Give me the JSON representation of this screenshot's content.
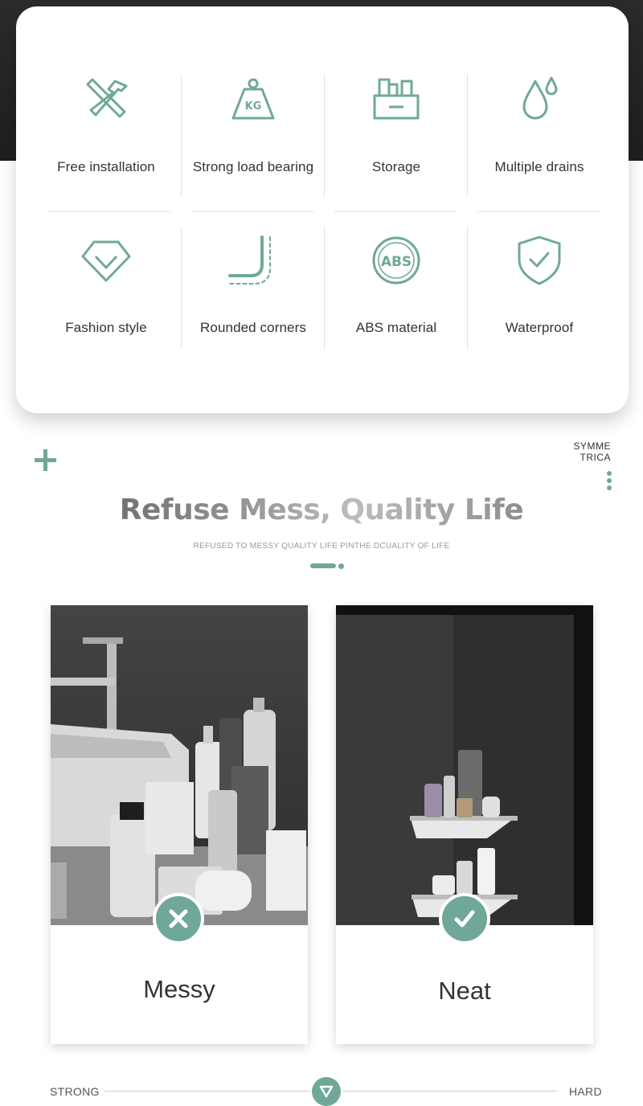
{
  "accent_color": "#6fa899",
  "features": [
    {
      "label": "Free installation",
      "icon": "hammer-wrench-icon"
    },
    {
      "label": "Strong load bearing",
      "icon": "kg-weight-icon",
      "icon_text": "KG"
    },
    {
      "label": "Storage",
      "icon": "storage-box-icon"
    },
    {
      "label": "Multiple drains",
      "icon": "water-drops-icon"
    },
    {
      "label": "Fashion style",
      "icon": "diamond-icon"
    },
    {
      "label": "Rounded corners",
      "icon": "rounded-corner-icon"
    },
    {
      "label": "ABS material",
      "icon": "abs-material-icon",
      "icon_text": "ABS"
    },
    {
      "label": "Waterproof",
      "icon": "shield-check-icon"
    }
  ],
  "brand": {
    "line1": "SYMME",
    "line2": "TRICA"
  },
  "headline": "Refuse Mess, Quality Life",
  "subline": "REFUSED TO MESSY QUALITY LIFE PINTHE DCUALITY OF LIFE",
  "comparison": [
    {
      "label": "Messy",
      "status": "cross"
    },
    {
      "label": "Neat",
      "status": "check"
    }
  ],
  "slider": {
    "left_label": "STRONG",
    "right_label": "HARD"
  }
}
